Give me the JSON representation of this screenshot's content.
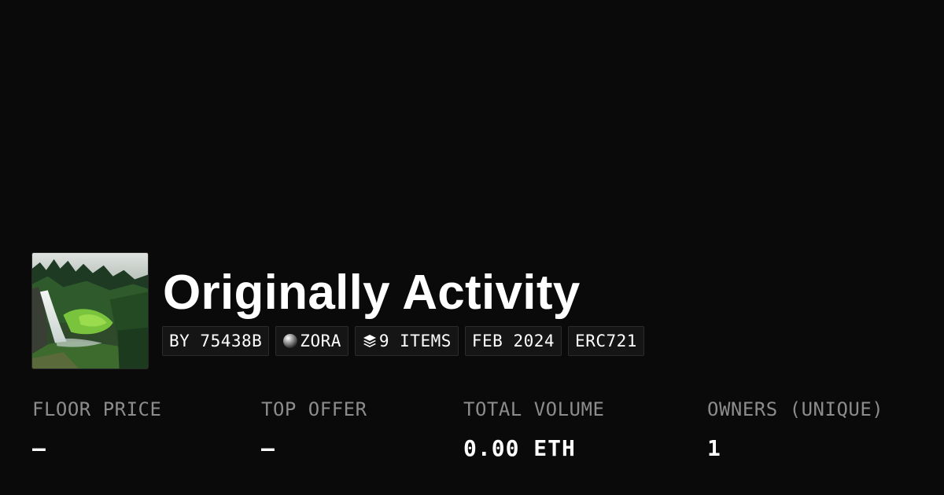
{
  "collection": {
    "title": "Originally Activity",
    "thumbnail_alt": "waterfall-forest-image"
  },
  "chips": {
    "creator": "BY 75438B",
    "network": "ZORA",
    "items": "9 ITEMS",
    "date": "FEB 2024",
    "standard": "ERC721"
  },
  "icons": {
    "network": "zora-orb-icon",
    "items": "layers-stack-icon"
  },
  "stats": {
    "floor_price": {
      "label": "FLOOR PRICE",
      "value": "–"
    },
    "top_offer": {
      "label": "TOP OFFER",
      "value": "–"
    },
    "total_volume": {
      "label": "TOTAL VOLUME",
      "value": "0.00 ETH"
    },
    "owners": {
      "label": "OWNERS (UNIQUE)",
      "value": "1"
    }
  },
  "colors": {
    "background": "#0a0a0a",
    "chip_background": "#151515",
    "chip_border": "#2c2c2c",
    "label_gray": "#8c8c8c",
    "text_white": "#ffffff"
  }
}
